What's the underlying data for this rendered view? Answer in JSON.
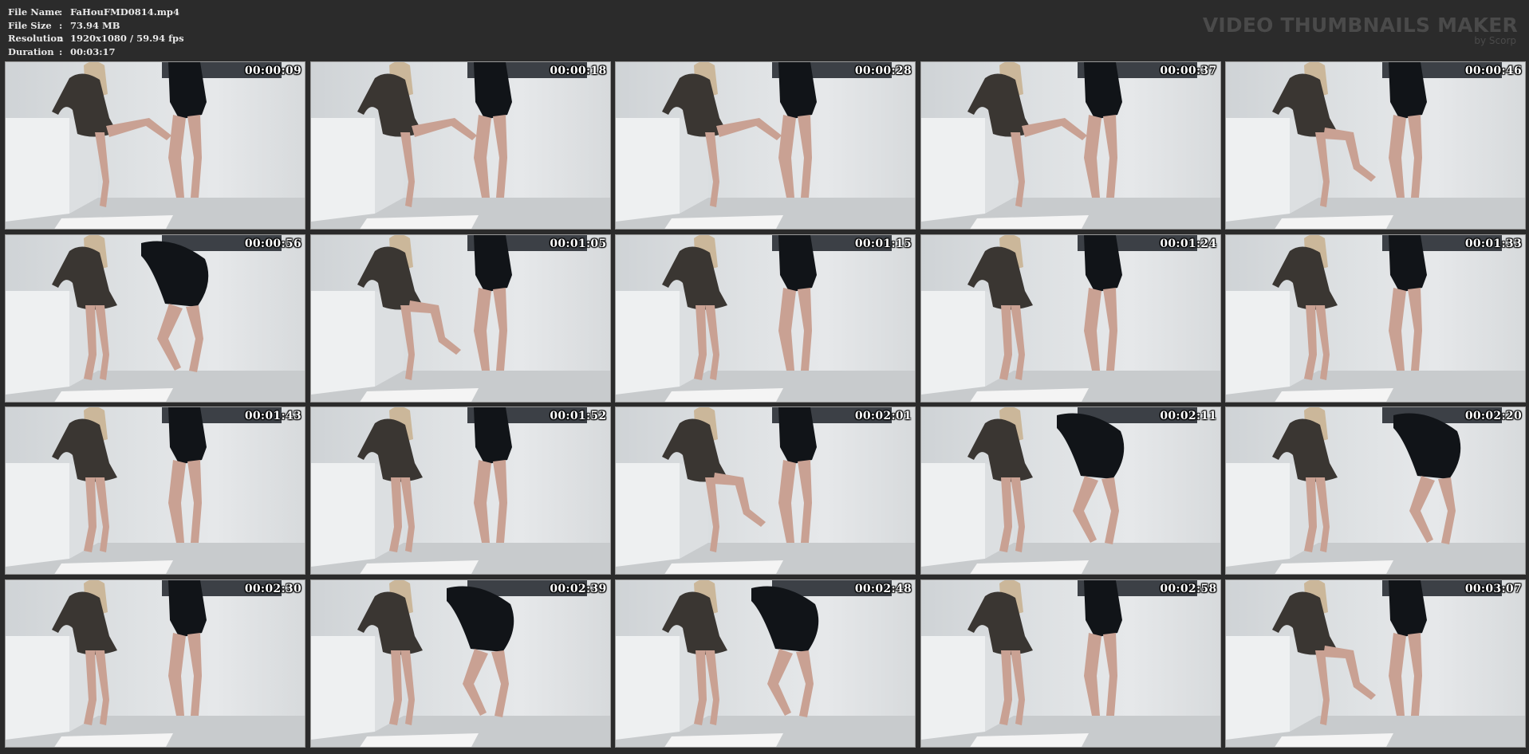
{
  "header": {
    "file_name_key": "File Name",
    "file_name": "FaHouFMD0814.mp4",
    "file_size_key": "File Size",
    "file_size": "73.94 MB",
    "resolution_key": "Resolution",
    "resolution": "1920x1080 / 59.94 fps",
    "duration_key": "Duration",
    "duration": "00:03:17",
    "separator": ":"
  },
  "brand": {
    "title": "VIDEO THUMBNAILS MAKER",
    "subtitle": "by Scorp"
  },
  "colors": {
    "background": "#2b2b2b",
    "wall": "#dfe2e4",
    "floor": "#c8cbcd",
    "cabinet": "#eef0f1",
    "rug": "#f4f4f4",
    "bodysuit": "#111418",
    "dress": "#3a3632",
    "skin": "#c9a193",
    "hair": "#cbb79a"
  },
  "thumbnails": [
    {
      "time": "00:00:09",
      "pose": "kick"
    },
    {
      "time": "00:00:18",
      "pose": "kick"
    },
    {
      "time": "00:00:28",
      "pose": "kick"
    },
    {
      "time": "00:00:37",
      "pose": "kick"
    },
    {
      "time": "00:00:46",
      "pose": "kick-low"
    },
    {
      "time": "00:00:56",
      "pose": "bent"
    },
    {
      "time": "00:01:05",
      "pose": "kick-low"
    },
    {
      "time": "00:01:15",
      "pose": "stand"
    },
    {
      "time": "00:01:24",
      "pose": "stand"
    },
    {
      "time": "00:01:33",
      "pose": "stand"
    },
    {
      "time": "00:01:43",
      "pose": "stand"
    },
    {
      "time": "00:01:52",
      "pose": "stand"
    },
    {
      "time": "00:02:01",
      "pose": "kick-low"
    },
    {
      "time": "00:02:11",
      "pose": "bent"
    },
    {
      "time": "00:02:20",
      "pose": "crouch"
    },
    {
      "time": "00:02:30",
      "pose": "stand"
    },
    {
      "time": "00:02:39",
      "pose": "bent"
    },
    {
      "time": "00:02:48",
      "pose": "bent"
    },
    {
      "time": "00:02:58",
      "pose": "stand"
    },
    {
      "time": "00:03:07",
      "pose": "kick-low"
    }
  ]
}
